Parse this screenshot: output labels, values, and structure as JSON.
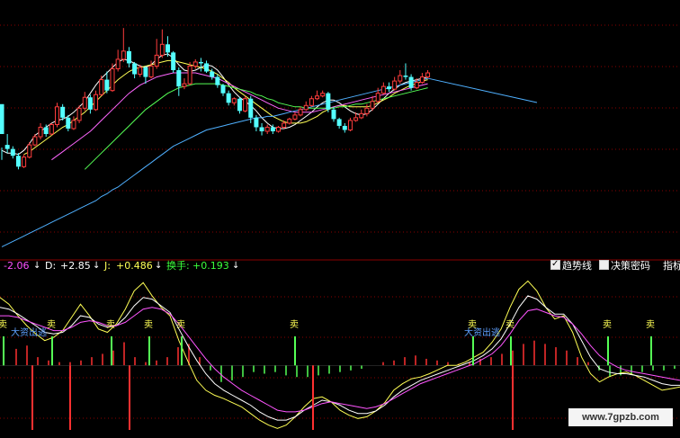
{
  "colors": {
    "background": "#000000",
    "up": "#ff3d3d",
    "down": "#54ffff",
    "ma5": "#ffffff",
    "ma10": "#ffff55",
    "ma20": "#ff66ff",
    "ma30": "#55ff55",
    "ma60": "#4fb0ff",
    "grid": "#8a0000",
    "sell_bar": "#55ff55",
    "buy_bar": "#ff3030"
  },
  "indicator_header": {
    "k_value": "-2.06",
    "d_label": "D:",
    "d_value": "+2.85",
    "j_label": "J:",
    "j_value": "+0.486",
    "turnover_label": "换手:",
    "turnover_value": "+0.193",
    "arrow_icon": "down-arrow-icon",
    "legend_trend": "趋势线",
    "legend_decision": "决策密码",
    "legend_indicator": "指标"
  },
  "watermark": "www.7gpzb.com",
  "chart_data": [
    {
      "type": "candlestick",
      "title": "",
      "candles": [
        [
          7.0,
          4.8,
          3.8,
          2.9
        ],
        [
          4.0,
          3.7,
          4.8,
          3.4
        ],
        [
          3.7,
          3.2,
          3.9,
          3.0
        ],
        [
          3.2,
          2.4,
          3.4,
          2.2
        ],
        [
          2.4,
          3.1,
          3.3,
          2.3
        ],
        [
          3.1,
          4.0,
          4.2,
          3.0
        ],
        [
          4.0,
          4.6,
          4.8,
          3.9
        ],
        [
          4.6,
          5.3,
          5.6,
          4.4
        ],
        [
          5.3,
          4.8,
          5.5,
          4.6
        ],
        [
          4.8,
          5.5,
          5.6,
          4.7
        ],
        [
          5.5,
          6.8,
          7.1,
          5.3
        ],
        [
          6.8,
          6.0,
          7.0,
          5.8
        ],
        [
          6.0,
          5.2,
          6.2,
          5.0
        ],
        [
          5.2,
          5.8,
          6.1,
          5.1
        ],
        [
          5.8,
          6.7,
          6.9,
          5.6
        ],
        [
          6.7,
          7.5,
          7.9,
          6.5
        ],
        [
          7.5,
          6.6,
          7.7,
          6.3
        ],
        [
          6.6,
          7.7,
          8.0,
          6.5
        ],
        [
          7.7,
          8.8,
          9.1,
          7.6
        ],
        [
          8.8,
          8.0,
          9.4,
          7.8
        ],
        [
          8.0,
          9.6,
          10.0,
          7.9
        ],
        [
          9.6,
          10.3,
          11.0,
          9.4
        ],
        [
          10.3,
          10.9,
          12.6,
          10.1
        ],
        [
          10.9,
          10.0,
          11.2,
          9.7
        ],
        [
          10.0,
          9.2,
          10.1,
          8.9
        ],
        [
          9.2,
          9.7,
          9.9,
          9.0
        ],
        [
          9.7,
          9.0,
          9.8,
          8.5
        ],
        [
          9.0,
          9.8,
          10.2,
          8.9
        ],
        [
          9.8,
          10.6,
          11.8,
          9.6
        ],
        [
          10.6,
          11.4,
          12.5,
          10.4
        ],
        [
          11.4,
          10.8,
          12.0,
          10.5
        ],
        [
          10.8,
          9.5,
          10.9,
          9.3
        ],
        [
          9.5,
          8.3,
          9.7,
          7.6
        ],
        [
          8.3,
          8.5,
          8.9,
          8.1
        ],
        [
          8.5,
          9.8,
          10.1,
          8.4
        ],
        [
          9.8,
          10.1,
          10.3,
          9.6
        ],
        [
          10.1,
          10.0,
          10.4,
          9.4
        ],
        [
          10.0,
          9.4,
          10.2,
          9.3
        ],
        [
          9.4,
          9.0,
          9.6,
          8.8
        ],
        [
          9.0,
          8.4,
          9.2,
          8.2
        ],
        [
          8.4,
          7.8,
          8.5,
          7.6
        ],
        [
          7.8,
          7.1,
          8.0,
          6.9
        ],
        [
          7.1,
          7.4,
          7.5,
          6.9
        ],
        [
          7.4,
          6.5,
          7.5,
          6.3
        ],
        [
          6.5,
          7.4,
          7.6,
          6.4
        ],
        [
          7.4,
          6.0,
          7.6,
          5.6
        ],
        [
          6.0,
          5.3,
          6.2,
          5.0
        ],
        [
          5.3,
          5.0,
          5.6,
          4.7
        ],
        [
          5.0,
          5.3,
          5.5,
          4.8
        ],
        [
          5.3,
          5.0,
          5.5,
          4.8
        ],
        [
          5.0,
          5.3,
          5.4,
          4.9
        ],
        [
          5.3,
          5.6,
          5.8,
          5.2
        ],
        [
          5.6,
          5.9,
          6.0,
          5.5
        ],
        [
          5.9,
          6.2,
          6.4,
          5.8
        ],
        [
          6.2,
          6.6,
          6.8,
          6.1
        ],
        [
          6.6,
          6.9,
          7.2,
          6.5
        ],
        [
          6.9,
          7.4,
          7.6,
          6.8
        ],
        [
          7.4,
          7.6,
          8.0,
          7.3
        ],
        [
          7.6,
          7.8,
          8.0,
          7.5
        ],
        [
          7.8,
          6.6,
          7.9,
          6.4
        ],
        [
          6.6,
          5.9,
          6.8,
          5.7
        ],
        [
          5.9,
          5.4,
          6.0,
          5.2
        ],
        [
          5.4,
          5.1,
          5.6,
          4.9
        ],
        [
          5.1,
          5.8,
          6.0,
          5.0
        ],
        [
          5.8,
          6.0,
          6.4,
          5.7
        ],
        [
          6.0,
          6.3,
          6.6,
          5.9
        ],
        [
          6.3,
          6.7,
          7.0,
          6.1
        ],
        [
          6.7,
          7.2,
          7.6,
          6.5
        ],
        [
          7.2,
          7.8,
          8.2,
          7.1
        ],
        [
          7.8,
          8.3,
          8.6,
          7.7
        ],
        [
          8.3,
          8.1,
          8.6,
          7.9
        ],
        [
          8.1,
          8.7,
          9.0,
          8.0
        ],
        [
          8.7,
          9.1,
          9.5,
          8.5
        ],
        [
          9.1,
          9.0,
          10.0,
          8.8
        ],
        [
          9.0,
          8.2,
          9.2,
          8.0
        ],
        [
          8.2,
          8.6,
          8.9,
          8.1
        ],
        [
          8.6,
          9.0,
          9.3,
          8.5
        ],
        [
          9.0,
          9.3,
          9.5,
          8.9
        ]
      ],
      "ma_lines": {
        "ma5": [
          3.6,
          3.4,
          3.4,
          3.3,
          3.6,
          4.1,
          4.7,
          5.0,
          5.3,
          5.6,
          5.8,
          5.9,
          6.1,
          6.4,
          6.8,
          7.2,
          7.8,
          8.4,
          8.9,
          9.3,
          9.7,
          10.1,
          10.3,
          10.2,
          10.0,
          9.8,
          9.7,
          9.9,
          10.3,
          10.6,
          10.7,
          10.4,
          9.9,
          9.5,
          9.4,
          9.5,
          9.7,
          9.9,
          9.8,
          9.5,
          9.0,
          8.4,
          7.9,
          7.5,
          7.2,
          6.9,
          6.5,
          6.0,
          5.6,
          5.3,
          5.2,
          5.2,
          5.3,
          5.5,
          5.8,
          6.1,
          6.4,
          6.8,
          7.1,
          7.3,
          7.3,
          7.1,
          6.8,
          6.5,
          6.3,
          6.2,
          6.3,
          6.6,
          7.0,
          7.4,
          7.8,
          8.1,
          8.4,
          8.6,
          8.7,
          8.8,
          8.9,
          9.0
        ],
        "ma10": [
          null,
          null,
          null,
          null,
          3.3,
          3.5,
          3.8,
          4.1,
          4.4,
          4.7,
          5.0,
          5.3,
          5.5,
          5.8,
          6.1,
          6.4,
          6.8,
          7.2,
          7.6,
          8.0,
          8.4,
          8.8,
          9.1,
          9.4,
          9.6,
          9.7,
          9.8,
          9.9,
          10.0,
          10.1,
          10.2,
          10.2,
          10.1,
          10.0,
          9.9,
          9.8,
          9.7,
          9.6,
          9.4,
          9.2,
          8.9,
          8.6,
          8.2,
          7.9,
          7.6,
          7.3,
          7.0,
          6.7,
          6.4,
          6.1,
          5.9,
          5.7,
          5.6,
          5.6,
          5.6,
          5.7,
          5.9,
          6.1,
          6.4,
          6.6,
          6.8,
          6.9,
          6.9,
          6.8,
          6.8,
          6.8,
          6.8,
          6.9,
          7.1,
          7.3,
          7.5,
          7.8,
          8.0,
          8.2,
          8.4,
          8.5,
          8.7,
          8.8
        ],
        "ma20": [
          null,
          null,
          null,
          null,
          null,
          null,
          null,
          null,
          null,
          2.9,
          3.2,
          3.5,
          3.8,
          4.1,
          4.4,
          4.7,
          5.0,
          5.4,
          5.8,
          6.2,
          6.6,
          7.0,
          7.4,
          7.8,
          8.1,
          8.4,
          8.6,
          8.8,
          9.0,
          9.1,
          9.2,
          9.3,
          9.3,
          9.3,
          9.3,
          9.3,
          9.2,
          9.1,
          9.0,
          8.9,
          8.7,
          8.5,
          8.3,
          8.1,
          7.9,
          7.7,
          7.5,
          7.3,
          7.1,
          6.9,
          6.7,
          6.6,
          6.5,
          6.4,
          6.4,
          6.4,
          6.4,
          6.5,
          6.6,
          6.7,
          6.8,
          6.9,
          7.0,
          7.1,
          7.2,
          7.3,
          7.4,
          7.5,
          7.6,
          7.7,
          7.8,
          7.9,
          8.0,
          8.1,
          8.2,
          8.3,
          8.4,
          8.5
        ],
        "ma30": [
          null,
          null,
          null,
          null,
          null,
          null,
          null,
          null,
          null,
          null,
          null,
          null,
          null,
          null,
          null,
          2.2,
          2.6,
          3.0,
          3.4,
          3.8,
          4.2,
          4.6,
          5.0,
          5.4,
          5.8,
          6.2,
          6.6,
          6.9,
          7.2,
          7.5,
          7.8,
          8.0,
          8.2,
          8.3,
          8.4,
          8.5,
          8.5,
          8.5,
          8.5,
          8.5,
          8.4,
          8.3,
          8.2,
          8.1,
          8.0,
          7.9,
          7.7,
          7.6,
          7.4,
          7.3,
          7.1,
          7.0,
          6.9,
          6.8,
          6.8,
          6.7,
          6.7,
          6.7,
          6.7,
          6.7,
          6.7,
          6.8,
          6.8,
          6.9,
          7.0,
          7.0,
          7.1,
          7.2,
          7.3,
          7.4,
          7.5,
          7.6,
          7.7,
          7.8,
          7.9,
          8.0,
          8.1,
          8.2
        ],
        "ma60": [
          -3.5,
          -3.3,
          -3.1,
          -2.9,
          -2.7,
          -2.5,
          -2.3,
          -2.1,
          -1.9,
          -1.7,
          -1.5,
          -1.3,
          -1.1,
          -0.9,
          -0.7,
          -0.5,
          -0.3,
          -0.1,
          0.2,
          0.4,
          0.7,
          0.9,
          1.2,
          1.5,
          1.8,
          2.1,
          2.4,
          2.7,
          3.0,
          3.3,
          3.6,
          3.9,
          4.1,
          4.3,
          4.5,
          4.7,
          4.9,
          5.1,
          5.2,
          5.3,
          5.4,
          5.5,
          5.6,
          5.7,
          5.8,
          5.9,
          6.0,
          6.0,
          6.1,
          6.1,
          6.2,
          6.3,
          6.4,
          6.5,
          6.6,
          6.7,
          6.8,
          6.9,
          7.0,
          7.1,
          7.2,
          7.3,
          7.4,
          7.5,
          7.6,
          7.7,
          7.8,
          7.9,
          8.0,
          8.1,
          8.2,
          8.3,
          8.4,
          8.5,
          8.6,
          8.7,
          8.8,
          8.9
        ]
      },
      "ylim": [
        -4,
        14
      ]
    },
    {
      "type": "line",
      "title": "",
      "signal_labels": {
        "sell": "卖",
        "escape": "大资出逃"
      },
      "sell_signals": [
        0,
        9,
        20,
        27,
        33,
        54,
        87,
        94,
        112,
        120
      ],
      "escape_signals": [
        2,
        86
      ],
      "series": [
        {
          "values": [
            82,
            74,
            60,
            48,
            38,
            30,
            34,
            42,
            58,
            74,
            60,
            44,
            40,
            50,
            68,
            90,
            100,
            84,
            70,
            60,
            30,
            5,
            -18,
            -30,
            -36,
            -40,
            -45,
            -50,
            -58,
            -66,
            -72,
            -76,
            -72,
            -62,
            -50,
            -40,
            -38,
            -44,
            -54,
            -60,
            -64,
            -62,
            -55,
            -45,
            -30,
            -22,
            -16,
            -14,
            -10,
            -5,
            0,
            0,
            4,
            10,
            16,
            28,
            44,
            70,
            92,
            102,
            90,
            70,
            56,
            60,
            40,
            10,
            -10,
            -20,
            -14,
            -10,
            -8,
            -12,
            -18,
            -24,
            -30,
            -28,
            -26
          ]
        },
        {
          "values": [
            70,
            68,
            62,
            55,
            48,
            40,
            38,
            40,
            48,
            60,
            58,
            50,
            46,
            48,
            58,
            72,
            82,
            80,
            72,
            64,
            44,
            24,
            6,
            -10,
            -22,
            -30,
            -36,
            -42,
            -48,
            -56,
            -62,
            -66,
            -66,
            -62,
            -54,
            -48,
            -42,
            -44,
            -48,
            -54,
            -58,
            -58,
            -55,
            -48,
            -38,
            -30,
            -24,
            -18,
            -14,
            -10,
            -6,
            -2,
            2,
            6,
            12,
            20,
            32,
            50,
            70,
            84,
            80,
            70,
            62,
            62,
            50,
            30,
            10,
            -4,
            -8,
            -10,
            -10,
            -12,
            -14,
            -18,
            -22,
            -24,
            -24
          ]
        },
        {
          "values": [
            60,
            60,
            58,
            54,
            50,
            46,
            42,
            42,
            46,
            52,
            54,
            52,
            48,
            48,
            52,
            60,
            68,
            70,
            68,
            62,
            50,
            36,
            22,
            8,
            -4,
            -14,
            -22,
            -30,
            -36,
            -42,
            -48,
            -54,
            -56,
            -56,
            -54,
            -50,
            -46,
            -44,
            -46,
            -48,
            -50,
            -52,
            -50,
            -46,
            -40,
            -34,
            -28,
            -22,
            -18,
            -14,
            -10,
            -6,
            -2,
            2,
            8,
            14,
            24,
            38,
            54,
            66,
            68,
            64,
            60,
            58,
            50,
            38,
            24,
            12,
            4,
            -2,
            -6,
            -8,
            -10,
            -12,
            -14,
            -16,
            -18
          ]
        }
      ],
      "histogram": [
        0,
        20,
        24,
        10,
        6,
        4,
        4,
        6,
        10,
        14,
        18,
        28,
        10,
        4,
        6,
        10,
        22,
        26,
        10,
        -6,
        -20,
        -18,
        -14,
        -8,
        -10,
        -8,
        -12,
        -14,
        -14,
        -12,
        -10,
        -8,
        -6,
        -4,
        0,
        4,
        6,
        10,
        12,
        8,
        6,
        4,
        2,
        4,
        8,
        10,
        14,
        18,
        26,
        30,
        26,
        22,
        18,
        10,
        4,
        -6,
        -14,
        -12,
        -10,
        -8,
        -6,
        -6,
        -4
      ],
      "ylim": [
        -80,
        110
      ]
    }
  ]
}
